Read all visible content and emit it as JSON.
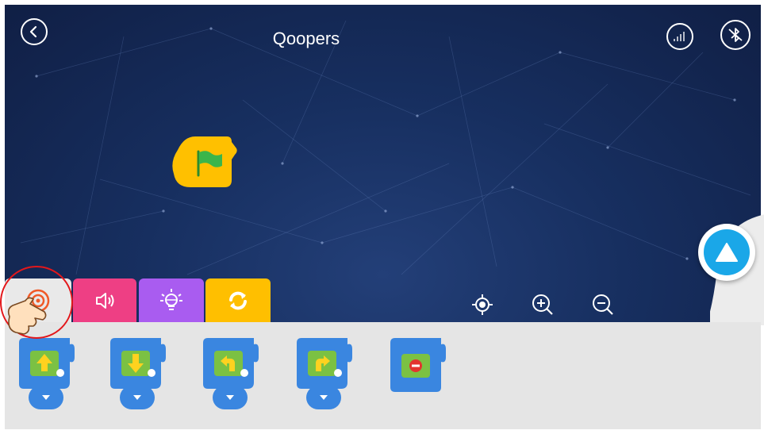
{
  "header": {
    "title": "Qoopers",
    "back_icon": "chevron-left-icon",
    "signal_icon": "signal-bars-icon",
    "bluetooth_icon": "bluetooth-off-icon"
  },
  "canvas": {
    "start_block_icon": "green-flag-icon",
    "start_block_color": "#ffc000",
    "fab_icon": "triangle-up-icon"
  },
  "tabs": [
    {
      "name": "motion",
      "icon": "target-icon",
      "color": "#e9e9e9",
      "selected": true
    },
    {
      "name": "sound",
      "icon": "speaker-icon",
      "color": "#ee3f84"
    },
    {
      "name": "lights",
      "icon": "bulb-icon",
      "color": "#a95cf0"
    },
    {
      "name": "control",
      "icon": "loop-icon",
      "color": "#ffbf00"
    }
  ],
  "zoom": {
    "center_icon": "crosshair-icon",
    "zoom_in_icon": "zoom-in-icon",
    "zoom_out_icon": "zoom-out-icon"
  },
  "palette": {
    "blocks": [
      {
        "name": "move-forward",
        "icon": "arrow-up-icon",
        "has_dropdown": true
      },
      {
        "name": "move-backward",
        "icon": "arrow-down-icon",
        "has_dropdown": true
      },
      {
        "name": "turn-left",
        "icon": "turn-left-icon",
        "has_dropdown": true
      },
      {
        "name": "turn-right",
        "icon": "turn-right-icon",
        "has_dropdown": true
      },
      {
        "name": "stop",
        "icon": "stop-icon",
        "has_dropdown": false
      }
    ],
    "block_color": "#3a86e0"
  },
  "hint": {
    "icon": "pointing-hand-icon"
  }
}
